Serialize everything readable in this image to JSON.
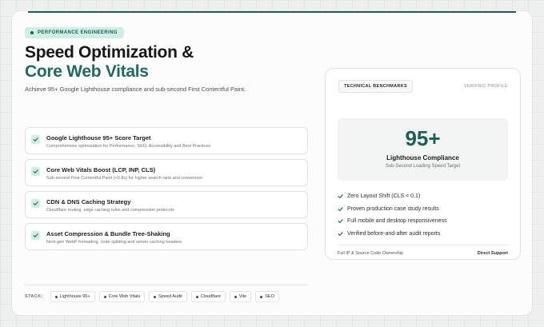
{
  "badge": "PERFORMANCE ENGINEERING",
  "heading": {
    "line1": "Speed Optimization &",
    "line2": "Core Web Vitals"
  },
  "subtitle": "Achieve 95+ Google Lighthouse compliance and sub-second First Contentful Paint.",
  "features": [
    {
      "title": "Google Lighthouse 95+ Score Target",
      "desc": "Comprehensive optimization for Performance, SEO, Accessibility and Best Practices"
    },
    {
      "title": "Core Web Vitals Boost (LCP, INP, CLS)",
      "desc": "Sub-second First Contentful Paint (<0.8s) for higher search rank and conversion"
    },
    {
      "title": "CDN & DNS Caching Strategy",
      "desc": "Cloudflare routing, edge caching rules and compression protocols"
    },
    {
      "title": "Asset Compression & Bundle Tree-Shaking",
      "desc": "Next-gen WebP formatting, code splitting and server caching headers"
    }
  ],
  "stack": {
    "label": "STACK:",
    "chips": [
      "Lighthouse 95+",
      "Core Web Vitals",
      "Speed Audit",
      "Cloudflare",
      "Vite",
      "SEO"
    ]
  },
  "panel": {
    "tab_label": "TECHNICAL BENCHMARKS",
    "verified_label": "VERIFIED PROFILE",
    "score": "95+",
    "score_title": "Lighthouse Compliance",
    "score_subtitle": "Sub-Second Loading Speed Target",
    "checks": [
      "Zero Layout Shift (CLS < 0.1)",
      "Proven production case study results",
      "Full mobile and desktop responsiveness",
      "Verified before-and-after audit reports"
    ],
    "footer_left": "Full IP & Source Code Ownership",
    "footer_right": "Direct Support"
  },
  "colors": {
    "accent": "#1f5e56",
    "accent_light": "#cfeee6",
    "heading_accent": "#1f6b5f"
  }
}
